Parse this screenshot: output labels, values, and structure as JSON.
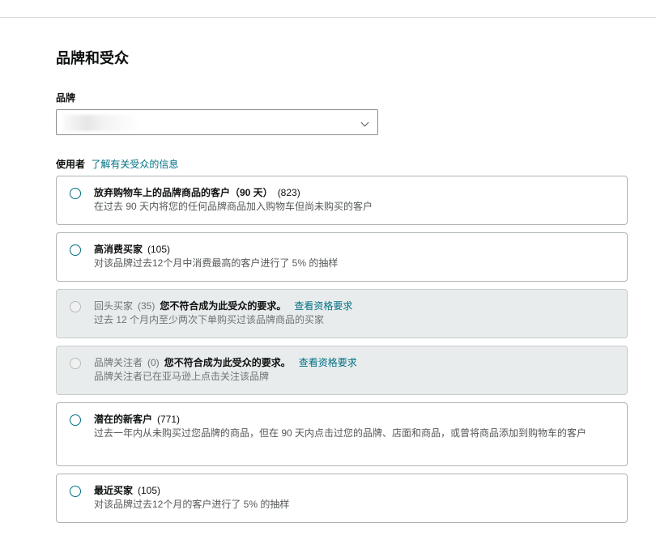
{
  "section_title": "品牌和受众",
  "brand": {
    "label": "品牌",
    "selected_value": ""
  },
  "used_by": {
    "label": "使用者",
    "link": "了解有关受众的信息"
  },
  "audiences": [
    {
      "name": "放弃购物车上的品牌商品的客户（90 天）",
      "count": "(823)",
      "description": "在过去 90 天内将您的任何品牌商品加入购物车但尚未购买的客户",
      "warning": "",
      "link": ""
    },
    {
      "name": "高消费买家",
      "count": "(105)",
      "description": "对该品牌过去12个月中消费最高的客户进行了 5% 的抽样",
      "warning": "",
      "link": ""
    },
    {
      "name": "回头买家",
      "count": "(35)",
      "description": "过去 12 个月内至少两次下单购买过该品牌商品的买家",
      "warning": "您不符合成为此受众的要求。",
      "link": "查看资格要求"
    },
    {
      "name": "品牌关注者",
      "count": "(0)",
      "description": "品牌关注者已在亚马逊上点击关注该品牌",
      "warning": "您不符合成为此受众的要求。",
      "link": "查看资格要求"
    },
    {
      "name": "潜在的新客户",
      "count": "(771)",
      "description": "过去一年内从未购买过您品牌的商品，但在 90 天内点击过您的品牌、店面和商品，或曾将商品添加到购物车的客户",
      "warning": "",
      "link": ""
    },
    {
      "name": "最近买家",
      "count": "(105)",
      "description": "对该品牌过去12个月的客户进行了 5% 的抽样",
      "warning": "",
      "link": ""
    }
  ],
  "colors": {
    "link": "#007185",
    "radio": "#007185",
    "disabled_bg": "#e9ecec"
  }
}
